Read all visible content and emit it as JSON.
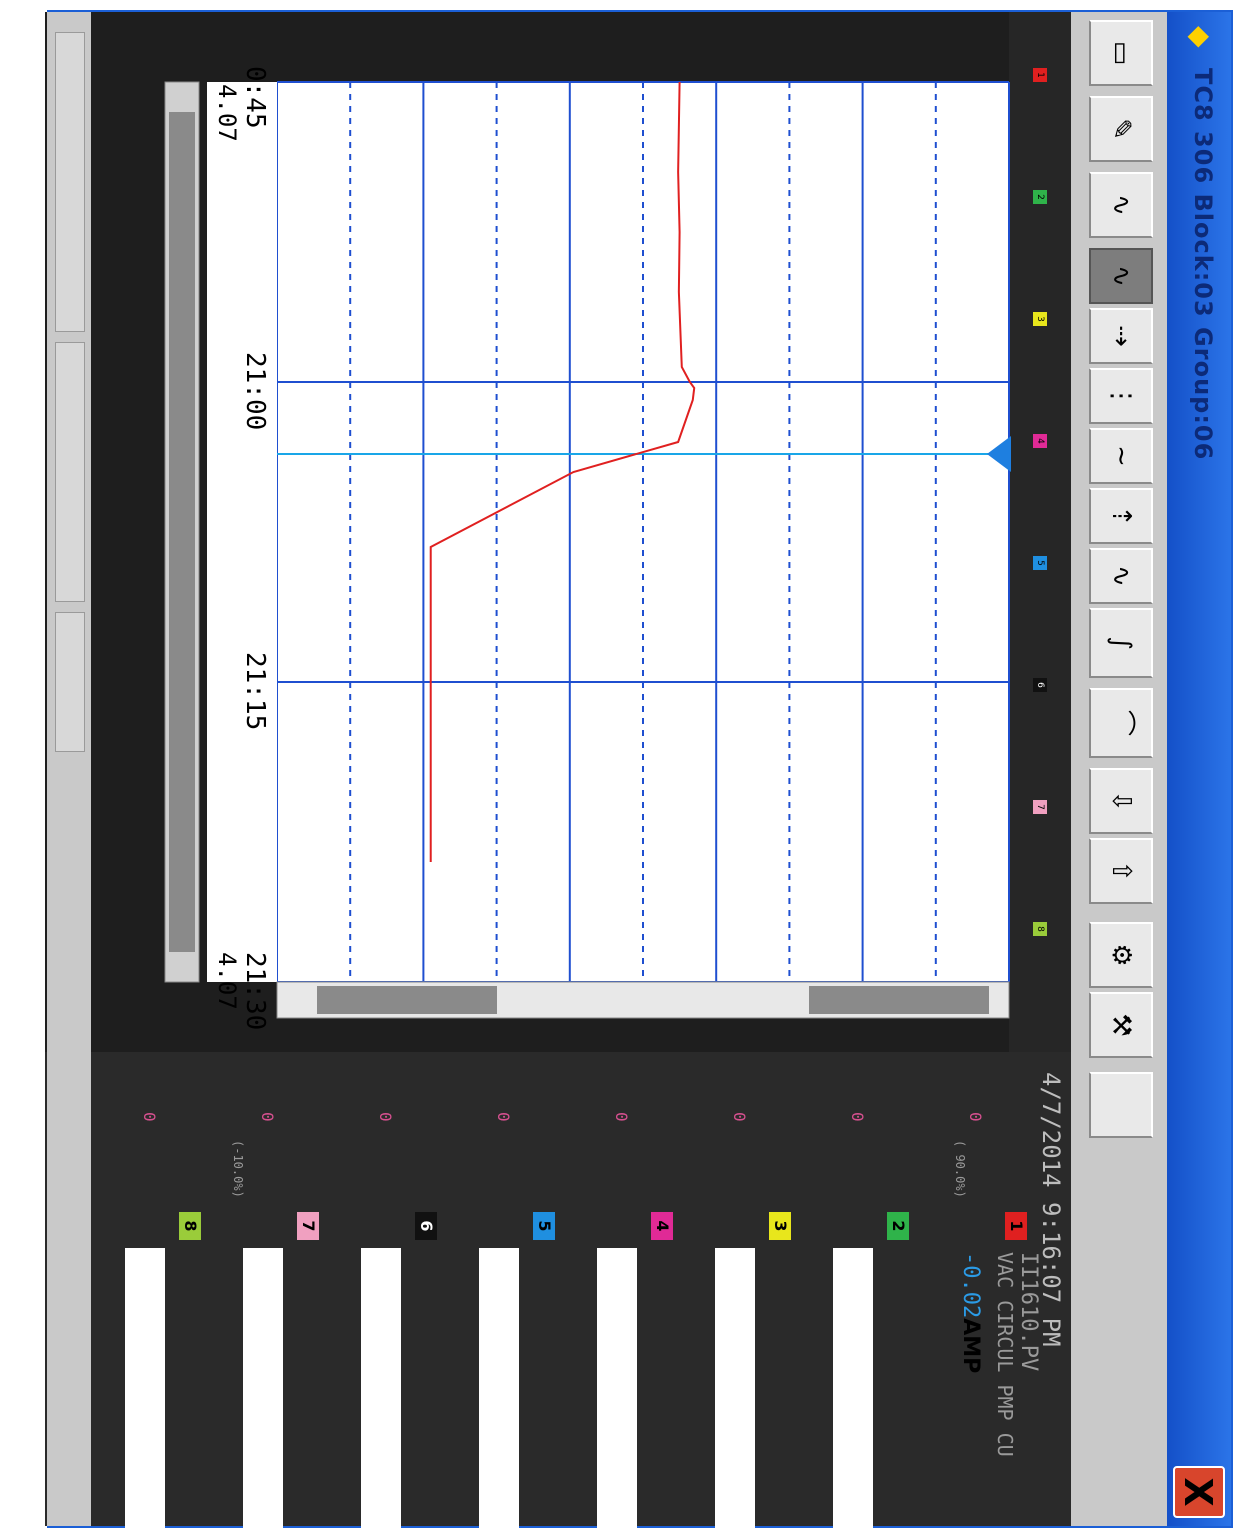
{
  "window": {
    "title": "TC8 306 Block:03 Group:06",
    "title_icon": "diamond-icon",
    "close_label": "X"
  },
  "toolbar": {
    "buttons": [
      {
        "name": "print-icon",
        "glyph": "▭"
      },
      {
        "name": "pen-icon",
        "glyph": "✎"
      },
      {
        "name": "trend-edit-icon",
        "glyph": "∿"
      },
      {
        "name": "trend-select-icon",
        "glyph": "∿"
      },
      {
        "name": "zoom-in-icon",
        "glyph": "⇢"
      },
      {
        "name": "trend-spread-icon",
        "glyph": "⋮"
      },
      {
        "name": "trend-shift-icon",
        "glyph": "∼"
      },
      {
        "name": "zoom-out-icon",
        "glyph": "⇡"
      },
      {
        "name": "trend-sine-icon",
        "glyph": "∿"
      },
      {
        "name": "trend-reset-icon",
        "glyph": "∫"
      },
      {
        "name": "trend-curve-icon",
        "glyph": "⌒"
      },
      {
        "name": "export-icon",
        "glyph": "⇩"
      },
      {
        "name": "import-icon",
        "glyph": "⇧"
      },
      {
        "name": "settings-icon",
        "glyph": "⚙"
      },
      {
        "name": "tools-icon",
        "glyph": "⚒"
      },
      {
        "name": "blank-icon",
        "glyph": ""
      }
    ]
  },
  "status": {
    "datetime": "4/7/2014 9:16:07 PM"
  },
  "axis": {
    "range_top": "( 90.0%)",
    "range_bottom": "(-10.0%)",
    "zero_label": "0"
  },
  "time_axis": {
    "ticks": [
      "0:45",
      "21:00",
      "21:15",
      "21:30"
    ],
    "left_value": "4.07",
    "right_value": "4.07"
  },
  "channels": [
    {
      "num": "1",
      "color": "#e02020",
      "tag": "II1610.PV",
      "desc": "VAC CIRCUL PMP CU",
      "value": "-0.02",
      "unit": "AMP"
    },
    {
      "num": "2",
      "color": "#2fb34a",
      "tag": "",
      "desc": "",
      "value": "",
      "unit": ""
    },
    {
      "num": "3",
      "color": "#e8e61c",
      "tag": "",
      "desc": "",
      "value": "",
      "unit": ""
    },
    {
      "num": "4",
      "color": "#e02a96",
      "tag": "",
      "desc": "",
      "value": "",
      "unit": ""
    },
    {
      "num": "5",
      "color": "#1f8fe0",
      "tag": "",
      "desc": "",
      "value": "",
      "unit": ""
    },
    {
      "num": "6",
      "color": "#111111",
      "tag": "",
      "desc": "",
      "value": "",
      "unit": ""
    },
    {
      "num": "7",
      "color": "#f0a0c0",
      "tag": "",
      "desc": "",
      "value": "",
      "unit": ""
    },
    {
      "num": "8",
      "color": "#9acc3a",
      "tag": "",
      "desc": "",
      "value": "",
      "unit": ""
    }
  ],
  "chart_data": {
    "type": "line",
    "series": [
      {
        "name": "II1610.PV",
        "color": "#e02020",
        "x": [
          0,
          0.3,
          0.5,
          0.7,
          0.95,
          1.0,
          1.02,
          1.06,
          1.2,
          1.3,
          1.55,
          2.6
        ],
        "y": [
          55,
          54.8,
          55,
          54.9,
          55.3,
          56.4,
          57,
          56.8,
          54.8,
          40.5,
          21,
          21
        ]
      }
    ],
    "cursor_x": 1.24,
    "grid": true,
    "ylim": [
      0,
      100
    ]
  }
}
